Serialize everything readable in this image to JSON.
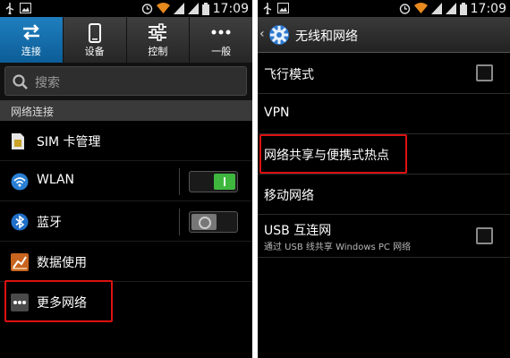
{
  "status_bar": {
    "time": "17:09"
  },
  "left_screen": {
    "tabs": [
      {
        "label": "连接",
        "icon": "swap-arrows-icon",
        "active": true
      },
      {
        "label": "设备",
        "icon": "phone-device-icon",
        "active": false
      },
      {
        "label": "控制",
        "icon": "sliders-icon",
        "active": false
      },
      {
        "label": "一般",
        "icon": "more-dots-icon",
        "active": false
      }
    ],
    "search": {
      "placeholder": "搜索",
      "icon": "search-icon"
    },
    "section_header": "网络连接",
    "items": [
      {
        "label": "SIM 卡管理",
        "icon": "sim-card-icon"
      },
      {
        "label": "WLAN",
        "icon": "wifi-icon",
        "switch": "on"
      },
      {
        "label": "蓝牙",
        "icon": "bluetooth-icon",
        "switch": "off"
      },
      {
        "label": "数据使用",
        "icon": "data-usage-icon"
      },
      {
        "label": "更多网络",
        "icon": "more-networks-icon",
        "highlighted": true
      }
    ]
  },
  "right_screen": {
    "title": "无线和网络",
    "items": [
      {
        "label": "飞行模式",
        "checkbox": true,
        "checked": false
      },
      {
        "label": "VPN"
      },
      {
        "label": "网络共享与便携式热点",
        "highlighted": true
      },
      {
        "label": "移动网络"
      },
      {
        "label": "USB 互连网",
        "sublabel": "通过 USB 线共享 Windows PC 网络",
        "checkbox": true,
        "checked": false
      }
    ]
  },
  "colors": {
    "active_tab": "#1a74b5",
    "highlight_box": "#dd1111",
    "switch_on": "#3fb73f"
  }
}
